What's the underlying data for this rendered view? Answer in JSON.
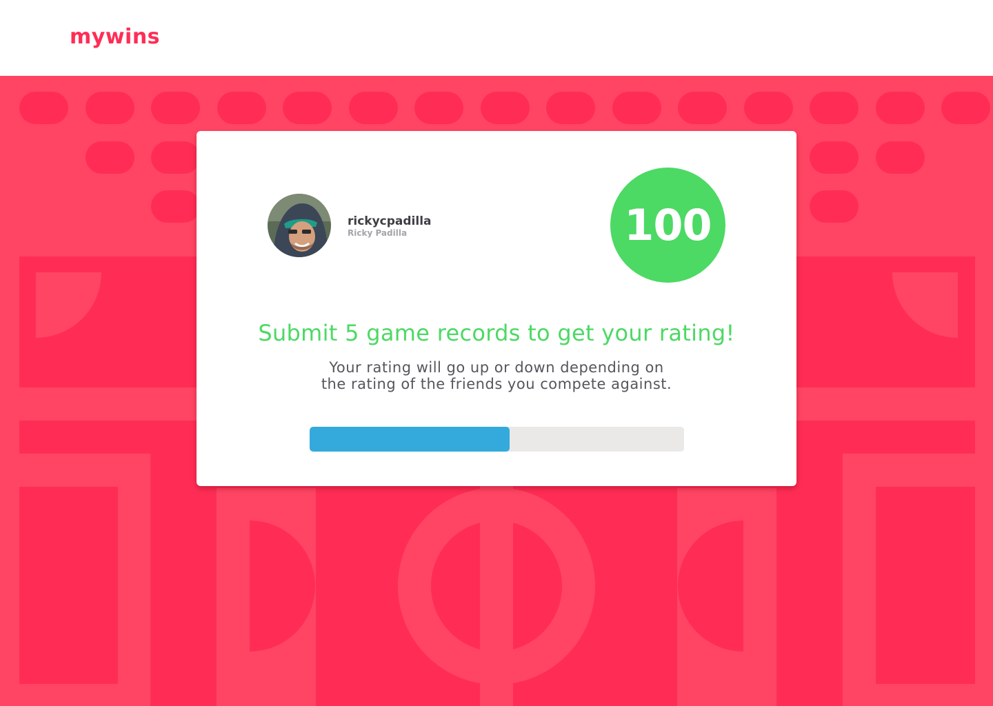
{
  "app": {
    "logo_text": "mywins",
    "brand_color": "#ff2d55",
    "background_color": "#ff4563"
  },
  "profile": {
    "username": "rickycpadilla",
    "full_name": "Ricky Padilla",
    "avatar_icon": "user-photo-avatar"
  },
  "rating": {
    "score": "100",
    "score_color": "#4cd964"
  },
  "message": {
    "headline": "Submit 5 game records to get your rating!",
    "line1": "Your rating will go up or down depending on",
    "line2": "the rating of the friends you compete against."
  },
  "progress": {
    "fraction": 0.534,
    "fill_color": "#34aadc",
    "track_color": "#ebe8e8"
  }
}
